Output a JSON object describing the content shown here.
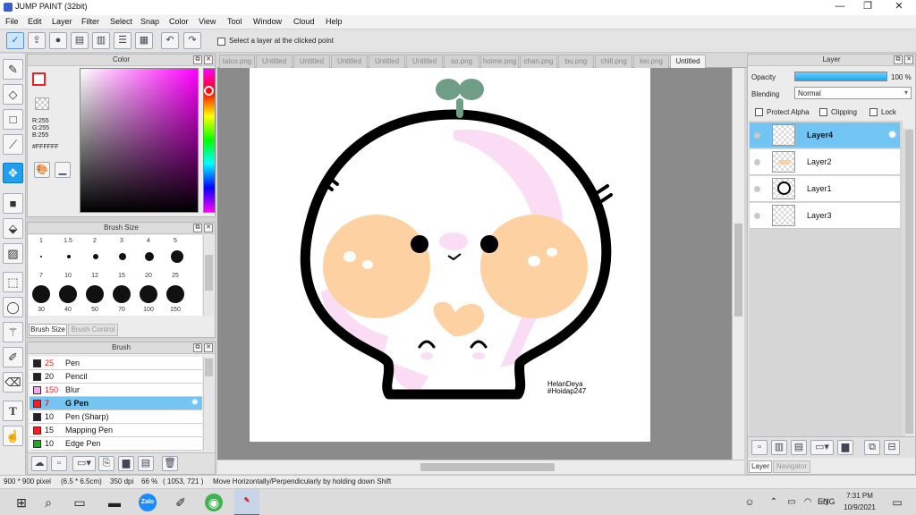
{
  "window": {
    "title": "JUMP PAINT (32bit)",
    "minimize": "—",
    "restore": "❐",
    "close": "✕"
  },
  "menubar": [
    "File",
    "Edit",
    "Layer",
    "Filter",
    "Select",
    "Snap",
    "Color",
    "View",
    "Tool",
    "Window",
    "Cloud",
    "Help"
  ],
  "toolbar": {
    "select_layer_label": "Select a layer at the clicked point",
    "undo_glyph": "↶",
    "redo_glyph": "↷"
  },
  "color_panel": {
    "title": "Color",
    "r": "R:255",
    "g": "G:255",
    "b": "B:255",
    "hex": "#FFFFFF",
    "hue_color": "#ff00ff"
  },
  "brush_size_panel": {
    "title": "Brush Size",
    "sizes": [
      "1",
      "1.5",
      "2",
      "3",
      "4",
      "5",
      "7",
      "10",
      "12",
      "15",
      "20",
      "25",
      "30",
      "40",
      "50",
      "70",
      "100",
      "150"
    ],
    "tab_active": "Brush Size",
    "tab_inactive": "Brush Control"
  },
  "brush_panel": {
    "title": "Brush",
    "brushes": [
      {
        "size": "25",
        "name": "Pen",
        "color": "#222222"
      },
      {
        "size": "20",
        "name": "Pencil",
        "color": "#222222"
      },
      {
        "size": "150",
        "name": "Blur",
        "color": "#f6a9e6"
      },
      {
        "size": "7",
        "name": "G Pen",
        "color": "#ee2222",
        "selected": true
      },
      {
        "size": "10",
        "name": "Pen (Sharp)",
        "color": "#222222"
      },
      {
        "size": "15",
        "name": "Mapping Pen",
        "color": "#ee2222"
      },
      {
        "size": "10",
        "name": "Edge Pen",
        "color": "#22aa22"
      }
    ]
  },
  "canvas_tabs": [
    "taico.png",
    "Untitled",
    "Untitled",
    "Untitled",
    "Untitled",
    "Untitled",
    "so.png",
    "hoime.png",
    "chan.png",
    "bu.png",
    "chill.png",
    "kei.png",
    "Untitled"
  ],
  "artwork": {
    "signature_line1": "HelanDeya",
    "signature_line2": "#Hoidap247"
  },
  "layer_panel": {
    "title": "Layer",
    "opacity_label": "Opacity",
    "opacity_value": "100 %",
    "opacity_fraction": 1.0,
    "blending_label": "Blending",
    "blending_value": "Normal",
    "protect_alpha": "Protect Alpha",
    "clipping": "Clipping",
    "lock": "Lock",
    "layers": [
      {
        "name": "Layer4",
        "selected": true
      },
      {
        "name": "Layer2"
      },
      {
        "name": "Layer1"
      },
      {
        "name": "Layer3"
      }
    ],
    "tab_active": "Layer",
    "tab_inactive": "Navigator"
  },
  "statusbar": {
    "size": "900 * 900 pixel",
    "physical": "(6.5 * 6.5cm)",
    "dpi": "350 dpi",
    "zoom": "66 %",
    "coords": "( 1053, 721 )",
    "hint": "Move Horizontally/Perpendicularly by holding down Shift"
  },
  "taskbar": {
    "lang": "ENG",
    "time": "7:31 PM",
    "date": "10/9/2021"
  }
}
